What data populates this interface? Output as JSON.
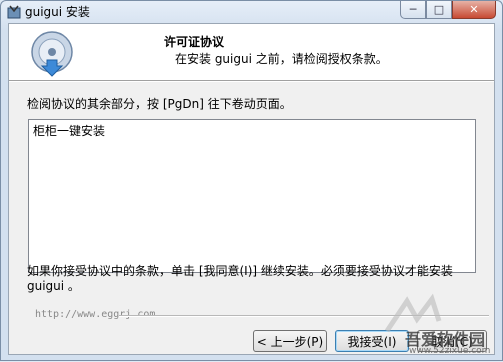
{
  "window": {
    "title": "guigui 安装"
  },
  "caption": {
    "minimize": "─",
    "maximize": "□",
    "close": "✕"
  },
  "header": {
    "title": "许可证协议",
    "subtitle": "在安装 guigui  之前，请检阅授权条款。"
  },
  "body": {
    "instruction": "检阅协议的其余部分，按 [PgDn] 往下卷动页面。",
    "license_text": "柜柜一键安装",
    "accept_prompt": "如果你接受协议中的条款，单击 [我同意(I)] 继续安装。必须要接受协议才能安装 guigui  。"
  },
  "footer": {
    "brand": "http://www.eggrj.com"
  },
  "buttons": {
    "back": "< 上一步(P)",
    "agree": "我接受(I)",
    "cancel": "取消(C)"
  },
  "watermark": {
    "text": "吾爱软件园",
    "url": "www.52zixue.com"
  },
  "icons": {
    "app": "installer-icon",
    "logo": "installer-disc-icon"
  },
  "colors": {
    "accent": "#3c7fb1",
    "close": "#c84a33"
  }
}
